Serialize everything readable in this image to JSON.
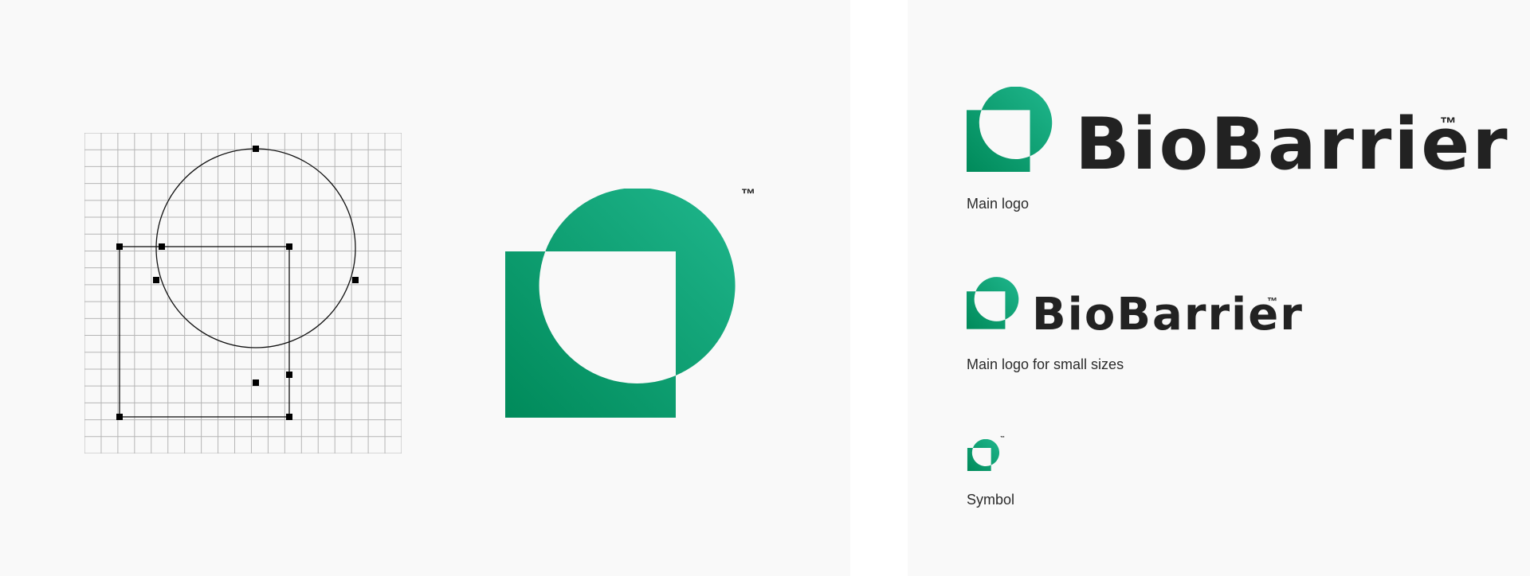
{
  "brand": {
    "wordmark": "BioBarrier",
    "trademark": "™",
    "colors": {
      "gradient_light": "#1fb68c",
      "gradient_dark": "#008a5a",
      "text": "#222222",
      "panel_background": "#f9f9f9",
      "grid_line": "#b5b5b5",
      "construction_line": "#111111"
    }
  },
  "construction": {
    "grid_columns": 19,
    "grid_rows": 19,
    "icons": [
      "construction-grid",
      "anchor-point-handles"
    ]
  },
  "variants": [
    {
      "caption": "Main logo",
      "shows_wordmark": true
    },
    {
      "caption": "Main logo for small sizes",
      "shows_wordmark": true
    },
    {
      "caption": "Symbol",
      "shows_wordmark": false
    }
  ]
}
